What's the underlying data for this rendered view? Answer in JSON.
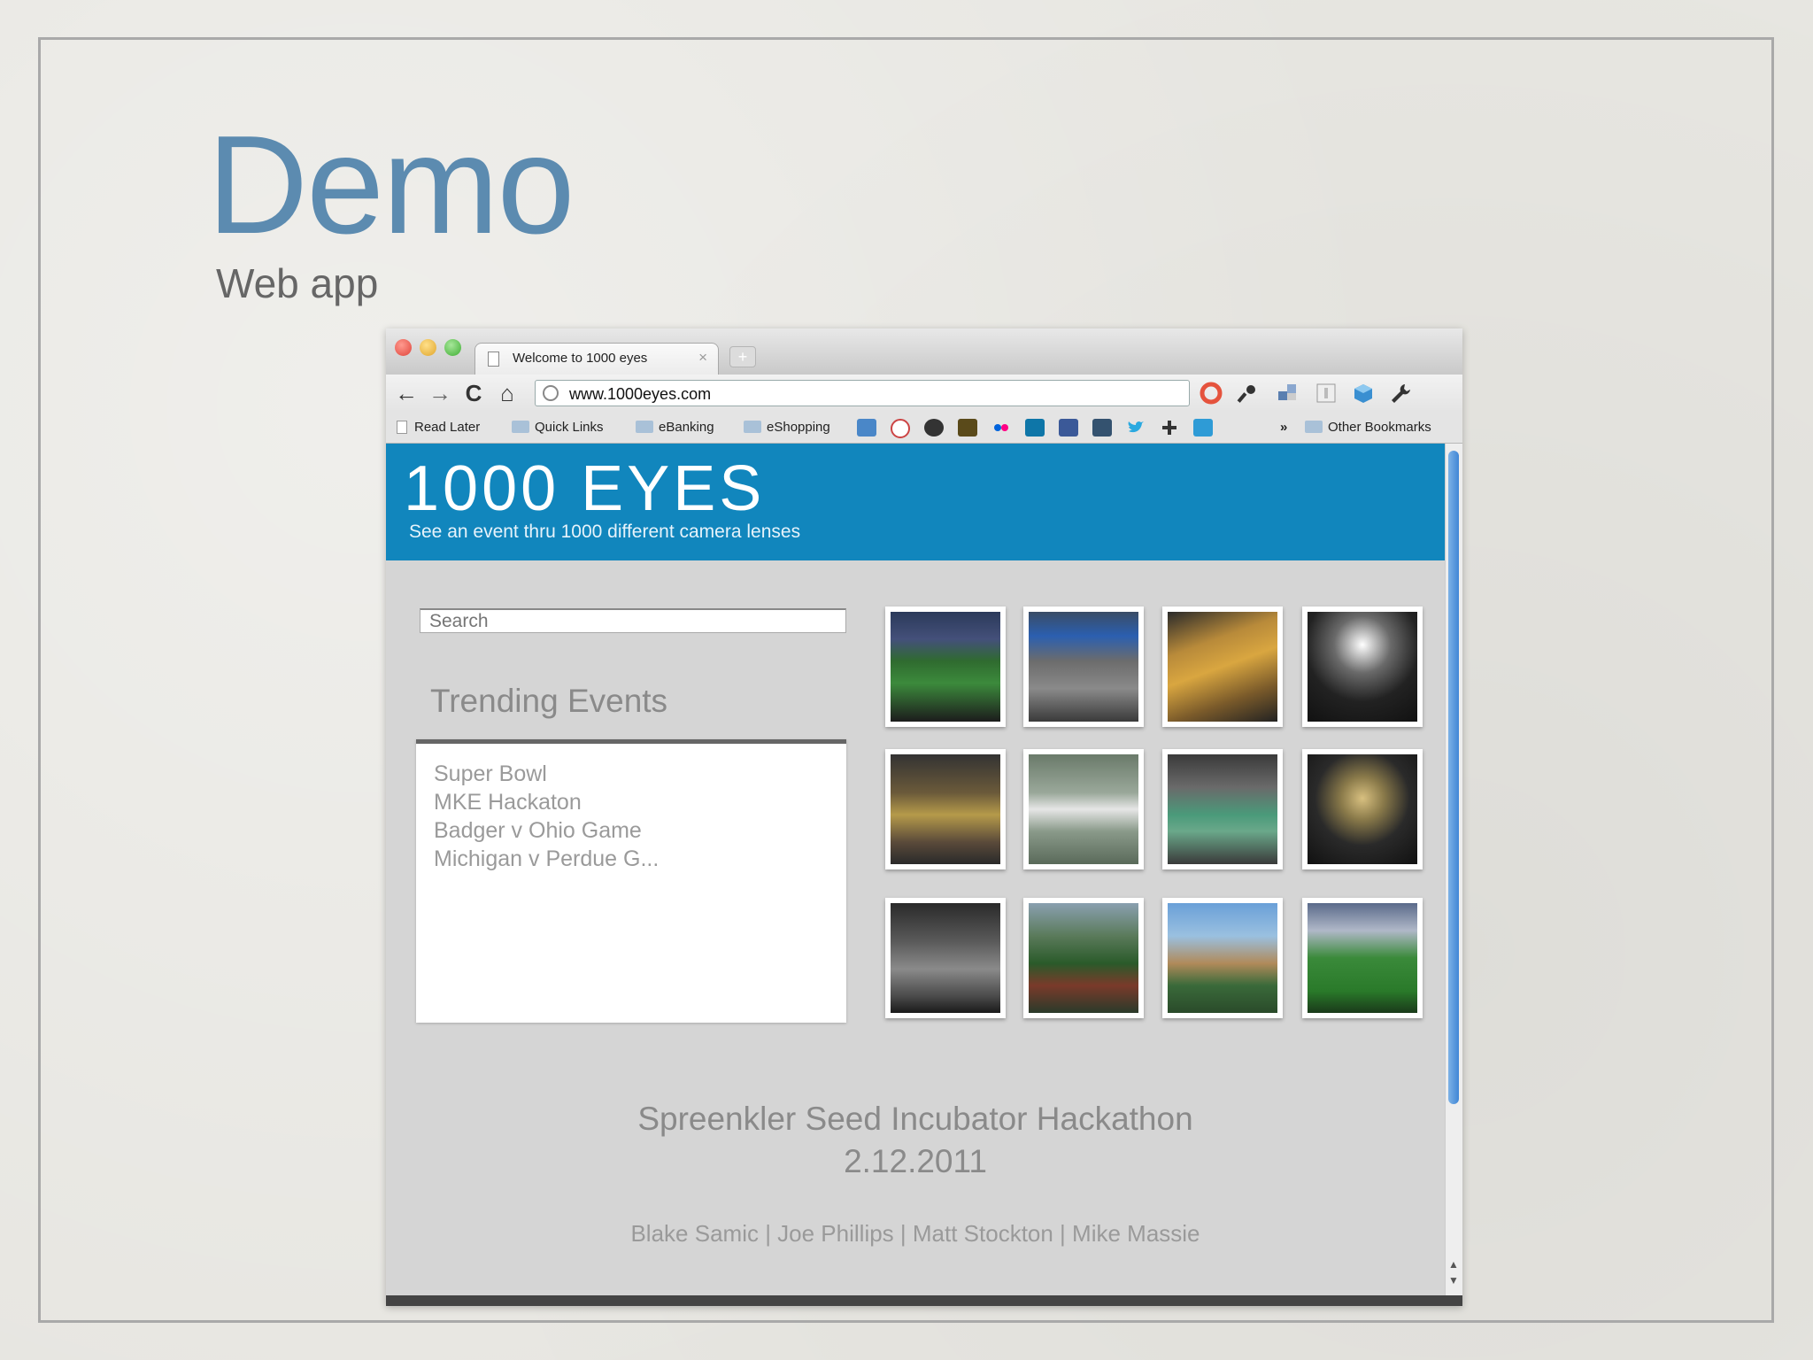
{
  "slide": {
    "title": "Demo",
    "subtitle": "Web app"
  },
  "browser": {
    "tab_title": "Welcome to 1000 eyes",
    "tab_close": "×",
    "new_tab": "+",
    "url": "www.1000eyes.com",
    "nav": {
      "back": "←",
      "forward": "→",
      "reload": "C",
      "home": "⌂"
    },
    "bookmarks": {
      "read_later": "Read Later",
      "quick_links": "Quick Links",
      "ebanking": "eBanking",
      "eshopping": "eShopping",
      "overflow": "»",
      "other": "Other Bookmarks"
    }
  },
  "site": {
    "logo": "1000 EYES",
    "tagline": "See an event thru 1000 different camera lenses",
    "search_placeholder": "Search",
    "trending_title": "Trending Events",
    "trending": [
      "Super Bowl",
      "MKE Hackaton",
      "Badger v Ohio Game",
      "Michigan v Perdue G..."
    ],
    "footer_title": "Spreenkler Seed Incubator Hackathon",
    "footer_date": "2.12.2011",
    "credits": "Blake Samic | Joe Phillips | Matt Stockton | Mike Massie"
  },
  "colors": {
    "header_blue": "#1186bd",
    "slide_title": "#5c8bb0",
    "scroll_thumb": "#3f86d6"
  }
}
